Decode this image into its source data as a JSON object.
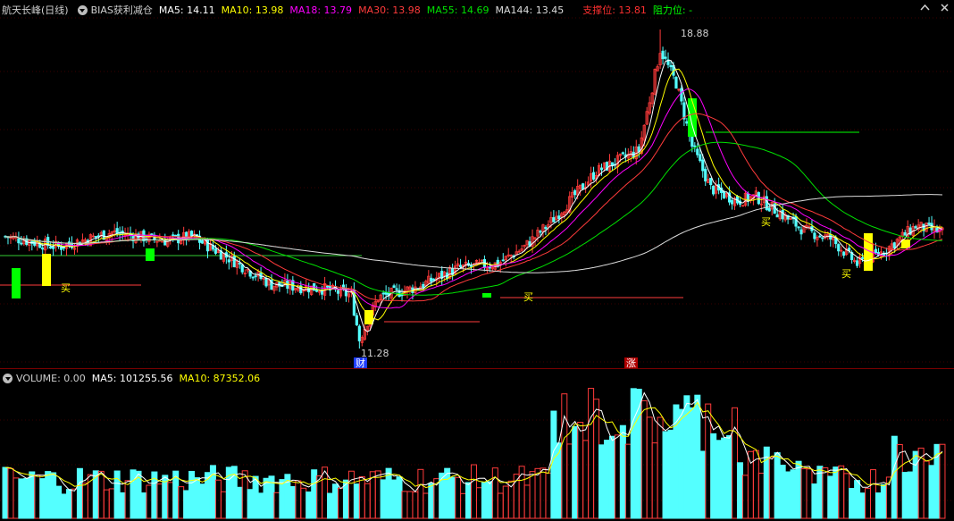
{
  "header": {
    "stock_name": "航天长峰(日线)",
    "indicator_name": "BIAS获利减仓",
    "ma": [
      {
        "label": "MA5: 14.11",
        "color": "#ffffff"
      },
      {
        "label": "MA10: 13.98",
        "color": "#ffff00"
      },
      {
        "label": "MA18: 13.79",
        "color": "#ff00ff"
      },
      {
        "label": "MA30: 13.98",
        "color": "#ff3b3b"
      },
      {
        "label": "MA55: 14.69",
        "color": "#00e000"
      },
      {
        "label": "MA144: 13.45",
        "color": "#dcdcdc"
      }
    ],
    "support_label": "支撑位: 13.81",
    "resistance_label": "阻力位: -",
    "support_color": "#ff3030",
    "resistance_color": "#00ff00"
  },
  "annotations": {
    "high_price": "18.88",
    "low_price": "11.28",
    "buy": "买",
    "cai_badge": "财",
    "zhang_badge": "涨"
  },
  "volume_header": {
    "title": "VOLUME: 0.00",
    "ma5": "MA5: 101255.56",
    "ma10": "MA10: 87352.06"
  },
  "colors": {
    "up": "#ff3b3b",
    "down": "#54ffff",
    "signal_yellow": "#ffff00",
    "signal_green": "#00ff00",
    "ma5": "#ffffff",
    "ma10": "#ffff00",
    "ma18": "#ff00ff",
    "ma30": "#ff3b3b",
    "ma55": "#00e000",
    "ma144": "#dcdcdc"
  },
  "chart_data": {
    "type": "candlestick",
    "high": 18.88,
    "low": 11.28,
    "support_level": 13.81,
    "resistance_level": "-"
  }
}
